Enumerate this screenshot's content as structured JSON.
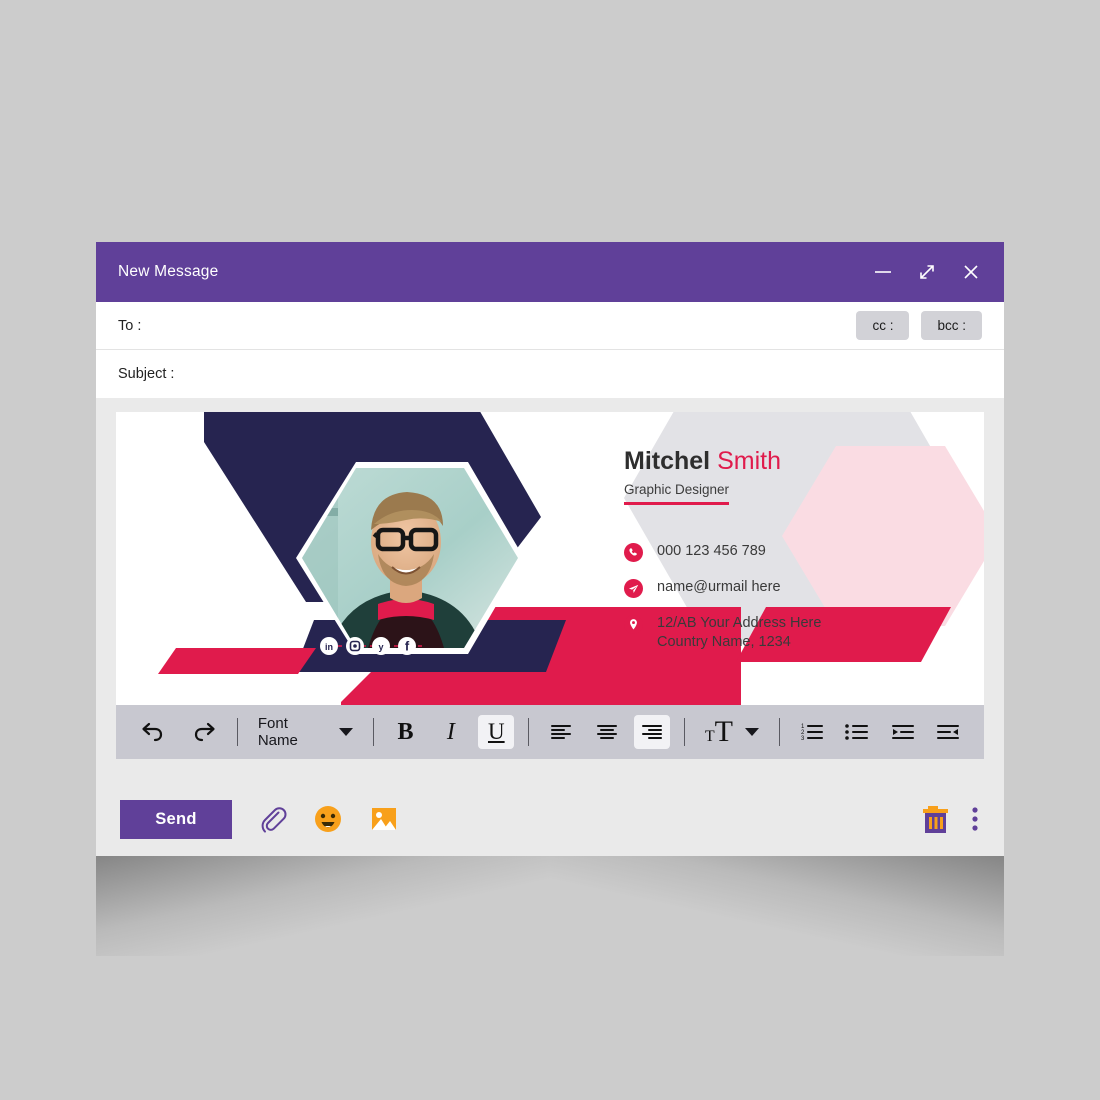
{
  "window": {
    "title": "New Message",
    "controls": [
      {
        "name": "minimize-icon",
        "label": "minimize"
      },
      {
        "name": "expand-icon",
        "label": "expand"
      },
      {
        "name": "close-icon",
        "label": "close"
      }
    ]
  },
  "compose": {
    "to_label": "To :",
    "to_value": "",
    "to_placeholder": "",
    "subject_label": "Subject :",
    "subject_value": "",
    "subject_placeholder": "",
    "cc_label": "cc :",
    "bcc_label": "bcc :"
  },
  "signature": {
    "first_name": "Mitchel",
    "last_name": "Smith",
    "role": "Graphic Designer",
    "contacts": [
      {
        "icon": "phone-icon",
        "lines": [
          "000 123 456 789"
        ]
      },
      {
        "icon": "send-mail-icon",
        "lines": [
          "name@urmail here"
        ]
      },
      {
        "icon": "location-pin-icon",
        "lines": [
          "12/AB Your Address Here",
          "Country Name, 1234"
        ]
      }
    ],
    "social": [
      {
        "name": "linkedin-icon",
        "label": "in"
      },
      {
        "name": "instagram-icon",
        "label": "ig"
      },
      {
        "name": "twitter-icon",
        "label": "tw"
      },
      {
        "name": "facebook-icon",
        "label": "fb"
      }
    ]
  },
  "toolbar": {
    "undo_label": "undo",
    "redo_label": "redo",
    "font_name_label": "Font Name",
    "bold_label": "B",
    "italic_label": "I",
    "underline_label": "U",
    "align_left_label": "align left",
    "align_center_label": "align center",
    "align_right_label": "align right",
    "font_size_label": "font size",
    "numbered_list_label": "numbered list",
    "bullet_list_label": "bullet list",
    "indent_label": "increase indent",
    "outdent_label": "decrease indent",
    "active_style": "underline",
    "active_align": "align-right"
  },
  "actions": {
    "send_label": "Send",
    "attach_label": "attach file",
    "emoji_label": "insert emoji",
    "image_label": "insert image",
    "delete_label": "discard draft",
    "more_label": "more options"
  },
  "colors": {
    "purple": "#604099",
    "crimson": "#E01B4C",
    "navy": "#262450",
    "pale_pink": "#FADCE3",
    "light_grey": "#E2E2E6",
    "orange": "#F8A01B",
    "toolbar_grey": "#C8C8D0",
    "page_background": "#CCCCCC"
  }
}
